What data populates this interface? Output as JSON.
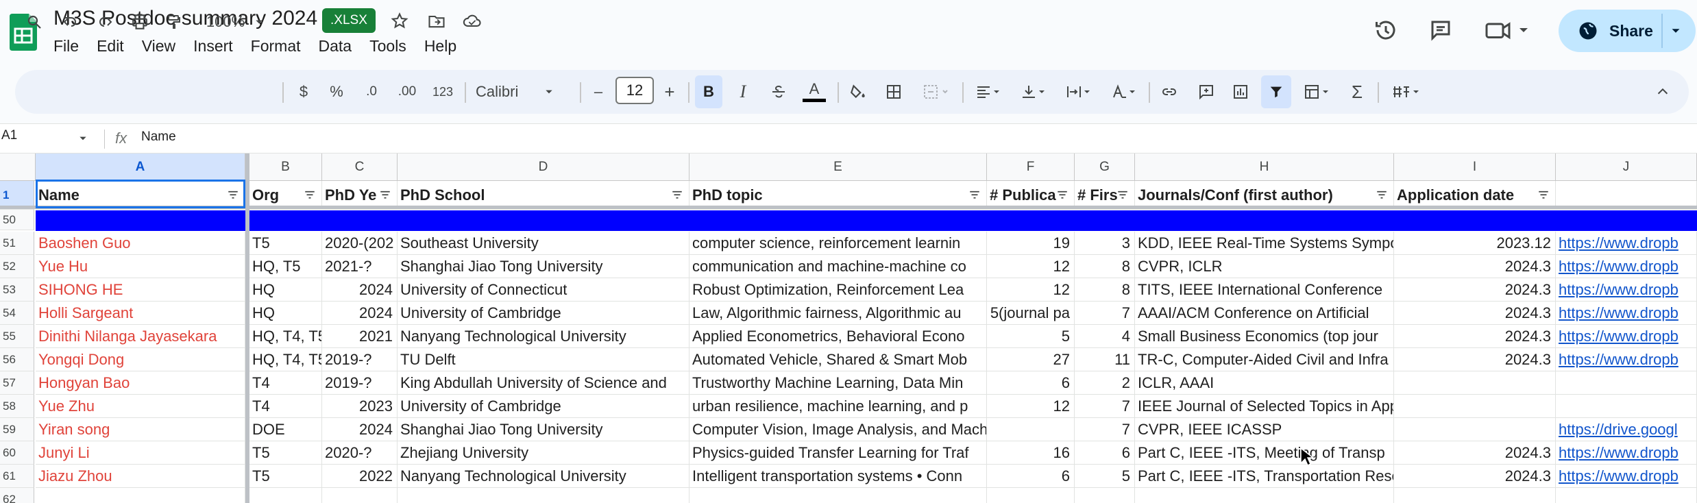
{
  "doc": {
    "title": "M3S Postdoc summary 2024",
    "badge": ".XLSX"
  },
  "menu": [
    "File",
    "Edit",
    "View",
    "Insert",
    "Format",
    "Data",
    "Tools",
    "Help"
  ],
  "share": {
    "label": "Share"
  },
  "toolbar": {
    "zoom": "100%",
    "currency": "$",
    "percent": "%",
    "dec_decrease": ".0",
    "dec_increase": ".00",
    "format_123": "123",
    "font": "Calibri",
    "font_size": "12",
    "minus": "–",
    "plus": "+",
    "bold": "B",
    "italic": "I",
    "text_color": "A",
    "sigma": "Σ"
  },
  "formula_bar": {
    "cell_ref": "A1",
    "fx": "fx",
    "value": "Name"
  },
  "columns": [
    "A",
    "B",
    "C",
    "D",
    "E",
    "F",
    "G",
    "H",
    "I",
    "J"
  ],
  "header_row": {
    "row_num": "1",
    "cells": [
      "Name",
      "Org",
      "PhD Ye",
      "PhD School",
      "PhD topic",
      "# Publica",
      "# Firs",
      "Journals/Conf (first author)",
      "Application date",
      ""
    ]
  },
  "rows": [
    {
      "row_num": "50",
      "cells": [
        "",
        "",
        "",
        "",
        "",
        "",
        "",
        "",
        "",
        ""
      ]
    },
    {
      "row_num": "51",
      "cells": [
        "Baoshen Guo",
        "T5",
        "2020-(202",
        "Southeast University",
        "computer science, reinforcement learnin",
        "19",
        "3",
        "KDD, IEEE Real-Time Systems Sympo",
        "2023.12",
        "https://www.dropb"
      ]
    },
    {
      "row_num": "52",
      "cells": [
        "Yue Hu",
        "HQ, T5",
        "2021-?",
        "Shanghai Jiao Tong University",
        "communication and machine-machine co",
        "12",
        "8",
        "CVPR, ICLR",
        "2024.3",
        "https://www.dropb"
      ]
    },
    {
      "row_num": "53",
      "cells": [
        "SIHONG HE",
        "HQ",
        "2024",
        "University of Connecticut",
        "Robust Optimization, Reinforcement Lea",
        "12",
        "8",
        "TITS, IEEE International Conference",
        "2024.3",
        "https://www.dropb"
      ]
    },
    {
      "row_num": "54",
      "cells": [
        "Holli Sargeant",
        "HQ",
        "2024",
        "University of Cambridge",
        "Law, Algorithmic fairness, Algorithmic au",
        "5(journal pa",
        "7",
        "AAAI/ACM Conference on Artificial",
        "2024.3",
        "https://www.dropb"
      ]
    },
    {
      "row_num": "55",
      "cells": [
        "Dinithi Nilanga Jayasekara",
        "HQ, T4, T5",
        "2021",
        "Nanyang Technological University",
        "Applied Econometrics, Behavioral Econo",
        "5",
        "4",
        "Small Business Economics (top jour",
        "2024.3",
        "https://www.dropb"
      ]
    },
    {
      "row_num": "56",
      "cells": [
        "Yongqi Dong",
        "HQ, T4, T5",
        "2019-?",
        "TU Delft",
        "Automated Vehicle, Shared & Smart Mob",
        "27",
        "11",
        "TR-C, Computer-Aided Civil and Infra",
        "2024.3",
        "https://www.dropb"
      ]
    },
    {
      "row_num": "57",
      "cells": [
        "Hongyan Bao",
        "T4",
        "2019-?",
        "King Abdullah University of Science and",
        "Trustworthy Machine Learning, Data Min",
        "6",
        "2",
        "ICLR, AAAI",
        "",
        ""
      ]
    },
    {
      "row_num": "58",
      "cells": [
        "Yue Zhu",
        "T4",
        "2023",
        "University of Cambridge",
        "urban resilience, machine learning, and p",
        "12",
        "7",
        "IEEE Journal of Selected Topics in Applied Earth Observati",
        "",
        ""
      ]
    },
    {
      "row_num": "59",
      "cells": [
        "Yiran song",
        "DOE",
        "2024",
        "Shanghai Jiao Tong University",
        "Computer Vision, Image Analysis, and Machine Learni",
        "",
        "7",
        "CVPR, IEEE ICASSP",
        "",
        "https://drive.googl"
      ]
    },
    {
      "row_num": "60",
      "cells": [
        "Junyi Li",
        "T5",
        "2020-?",
        "Zhejiang University",
        "Physics-guided Transfer Learning for Traf",
        "16",
        "6",
        "Part C, IEEE -ITS, Meeting of Transp",
        "2024.3",
        "https://www.dropb"
      ]
    },
    {
      "row_num": "61",
      "cells": [
        "Jiazu Zhou",
        "T5",
        "2022",
        "Nanyang Technological University",
        "Intelligent transportation systems • Conn",
        "6",
        "5",
        "Part C, IEEE -ITS, Transportation Resear",
        "2024.3",
        "https://www.dropb"
      ]
    },
    {
      "row_num": "62",
      "cells": [
        "",
        "",
        "",
        "",
        "",
        "",
        "",
        "",
        "",
        ""
      ]
    }
  ],
  "colors": {
    "name_red": "#e0433a",
    "link_blue": "#1155cc",
    "share_bg": "#c2e7ff",
    "band_blue": "#0000ff",
    "selection": "#1a73e8"
  }
}
